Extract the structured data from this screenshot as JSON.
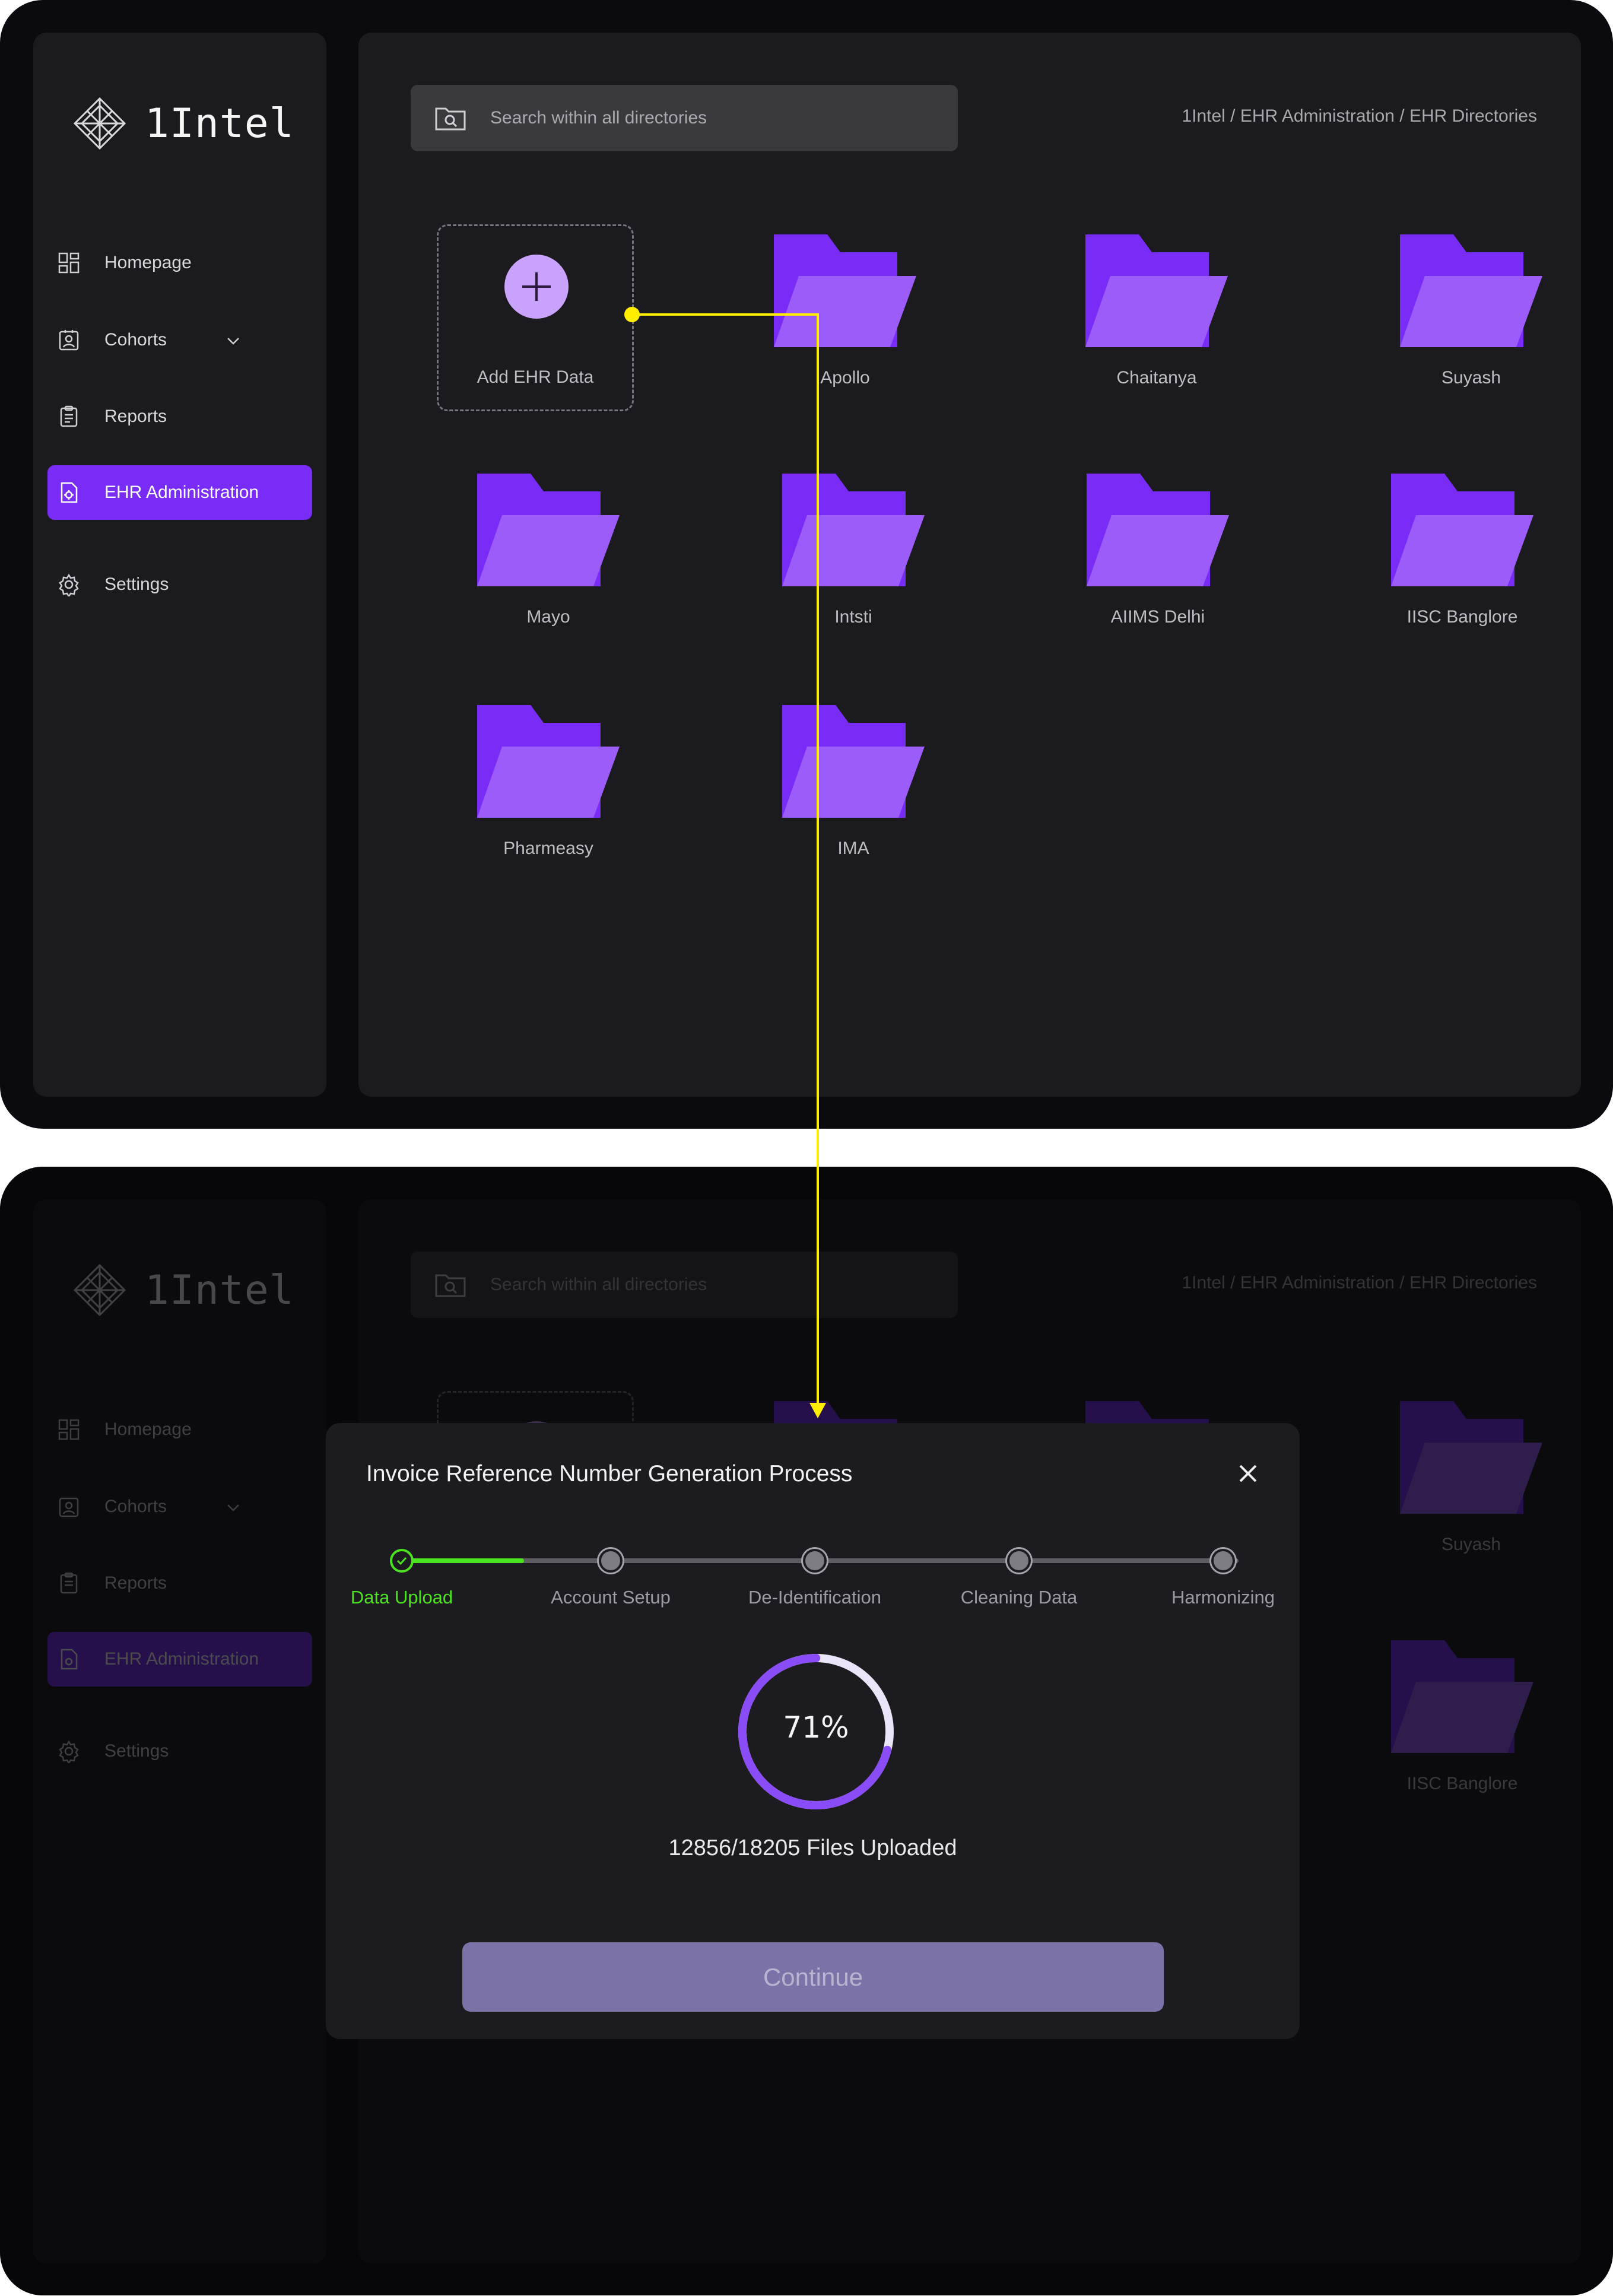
{
  "app": {
    "name": "1Intel",
    "logo_icon": "diamond-compass-logo"
  },
  "colors": {
    "accent": "#7a2cf7",
    "folder_back": "#7a2cf7",
    "folder_front": "#9b5cf9",
    "success": "#4be21f",
    "connector": "#ffee00"
  },
  "sidebar": {
    "items": [
      {
        "label": "Homepage",
        "icon": "grid-icon"
      },
      {
        "label": "Cohorts",
        "icon": "user-badge-icon"
      },
      {
        "label": "Reports",
        "icon": "clipboard-icon"
      },
      {
        "label": "EHR Administration",
        "icon": "document-gear-icon"
      },
      {
        "label": "Settings",
        "icon": "gear-icon"
      }
    ]
  },
  "search": {
    "placeholder": "Search within all directories"
  },
  "breadcrumb": "1Intel / EHR Administration / EHR Directories",
  "add_tile": {
    "label": "Add EHR Data"
  },
  "folders": [
    {
      "label": "Apollo"
    },
    {
      "label": "Chaitanya"
    },
    {
      "label": "Suyash"
    },
    {
      "label": "Mayo"
    },
    {
      "label": "Intsti"
    },
    {
      "label": "AIIMS Delhi"
    },
    {
      "label": "IISC Banglore"
    },
    {
      "label": "Pharmeasy"
    },
    {
      "label": "IMA"
    }
  ],
  "modal": {
    "title": "Invoice Reference Number Generation Process",
    "close_icon": "close-icon",
    "steps": [
      {
        "label": "Data Upload",
        "status": "done"
      },
      {
        "label": "Account Setup",
        "status": "pending"
      },
      {
        "label": "De-Identification",
        "status": "pending"
      },
      {
        "label": "Cleaning Data",
        "status": "pending"
      },
      {
        "label": "Harmonizing",
        "status": "pending"
      }
    ],
    "first_segment_progress": 0.6,
    "progress_percent": 71,
    "progress_label": "71%",
    "files_text": "12856/18205 Files Uploaded",
    "continue_label": "Continue"
  }
}
